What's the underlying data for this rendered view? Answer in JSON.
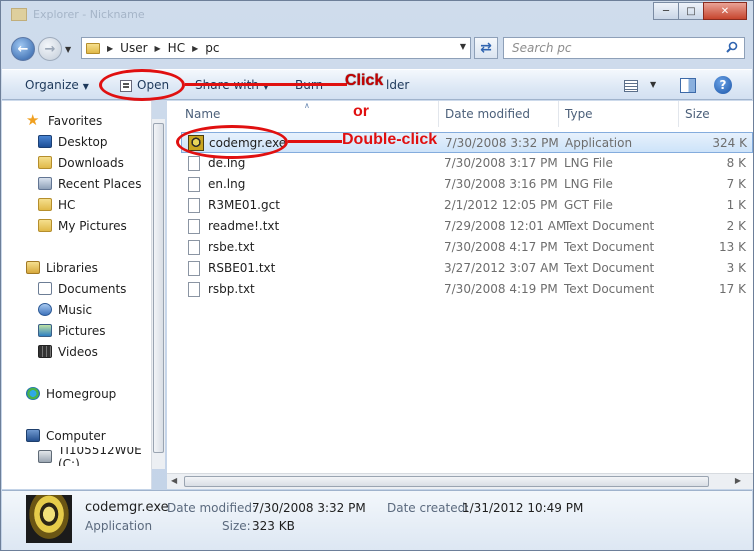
{
  "window": {
    "title": "Explorer - Nickname"
  },
  "address": {
    "crumbs": [
      "User",
      "HC",
      "pc"
    ],
    "search_placeholder": "Search pc"
  },
  "toolbar": {
    "organize": "Organize",
    "open": "Open",
    "share_with": "Share with",
    "burn": "Burn",
    "new_folder": "lder"
  },
  "columns": {
    "name": "Name",
    "date": "Date modified",
    "type": "Type",
    "size": "Size"
  },
  "navpane": {
    "favorites": "Favorites",
    "favorites_items": [
      "Desktop",
      "Downloads",
      "Recent Places",
      "HC",
      "My Pictures"
    ],
    "libraries": "Libraries",
    "libraries_items": [
      "Documents",
      "Music",
      "Pictures",
      "Videos"
    ],
    "homegroup": "Homegroup",
    "computer": "Computer",
    "drive": "TI105512W0E (C:)"
  },
  "files": [
    {
      "name": "codemgr.exe",
      "date": "7/30/2008 3:32 PM",
      "type": "Application",
      "size": "324 K"
    },
    {
      "name": "de.lng",
      "date": "7/30/2008 3:17 PM",
      "type": "LNG File",
      "size": "8 K"
    },
    {
      "name": "en.lng",
      "date": "7/30/2008 3:16 PM",
      "type": "LNG File",
      "size": "7 K"
    },
    {
      "name": "R3ME01.gct",
      "date": "2/1/2012 12:05 PM",
      "type": "GCT File",
      "size": "1 K"
    },
    {
      "name": "readme!.txt",
      "date": "7/29/2008 12:01 AM",
      "type": "Text Document",
      "size": "2 K"
    },
    {
      "name": "rsbe.txt",
      "date": "7/30/2008 4:17 PM",
      "type": "Text Document",
      "size": "13 K"
    },
    {
      "name": "RSBE01.txt",
      "date": "3/27/2012 3:07 AM",
      "type": "Text Document",
      "size": "3 K"
    },
    {
      "name": "rsbp.txt",
      "date": "7/30/2008 4:19 PM",
      "type": "Text Document",
      "size": "17 K"
    }
  ],
  "details": {
    "name": "codemgr.exe",
    "kind": "Application",
    "date_modified_label": "Date modified:",
    "date_modified": "7/30/2008 3:32 PM",
    "size_label": "Size:",
    "size": "323 KB",
    "date_created_label": "Date created:",
    "date_created": "1/31/2012 10:49 PM"
  },
  "annotations": {
    "click": "Click",
    "or": "or",
    "double_click": "Double-click",
    "color": "#e01010"
  }
}
